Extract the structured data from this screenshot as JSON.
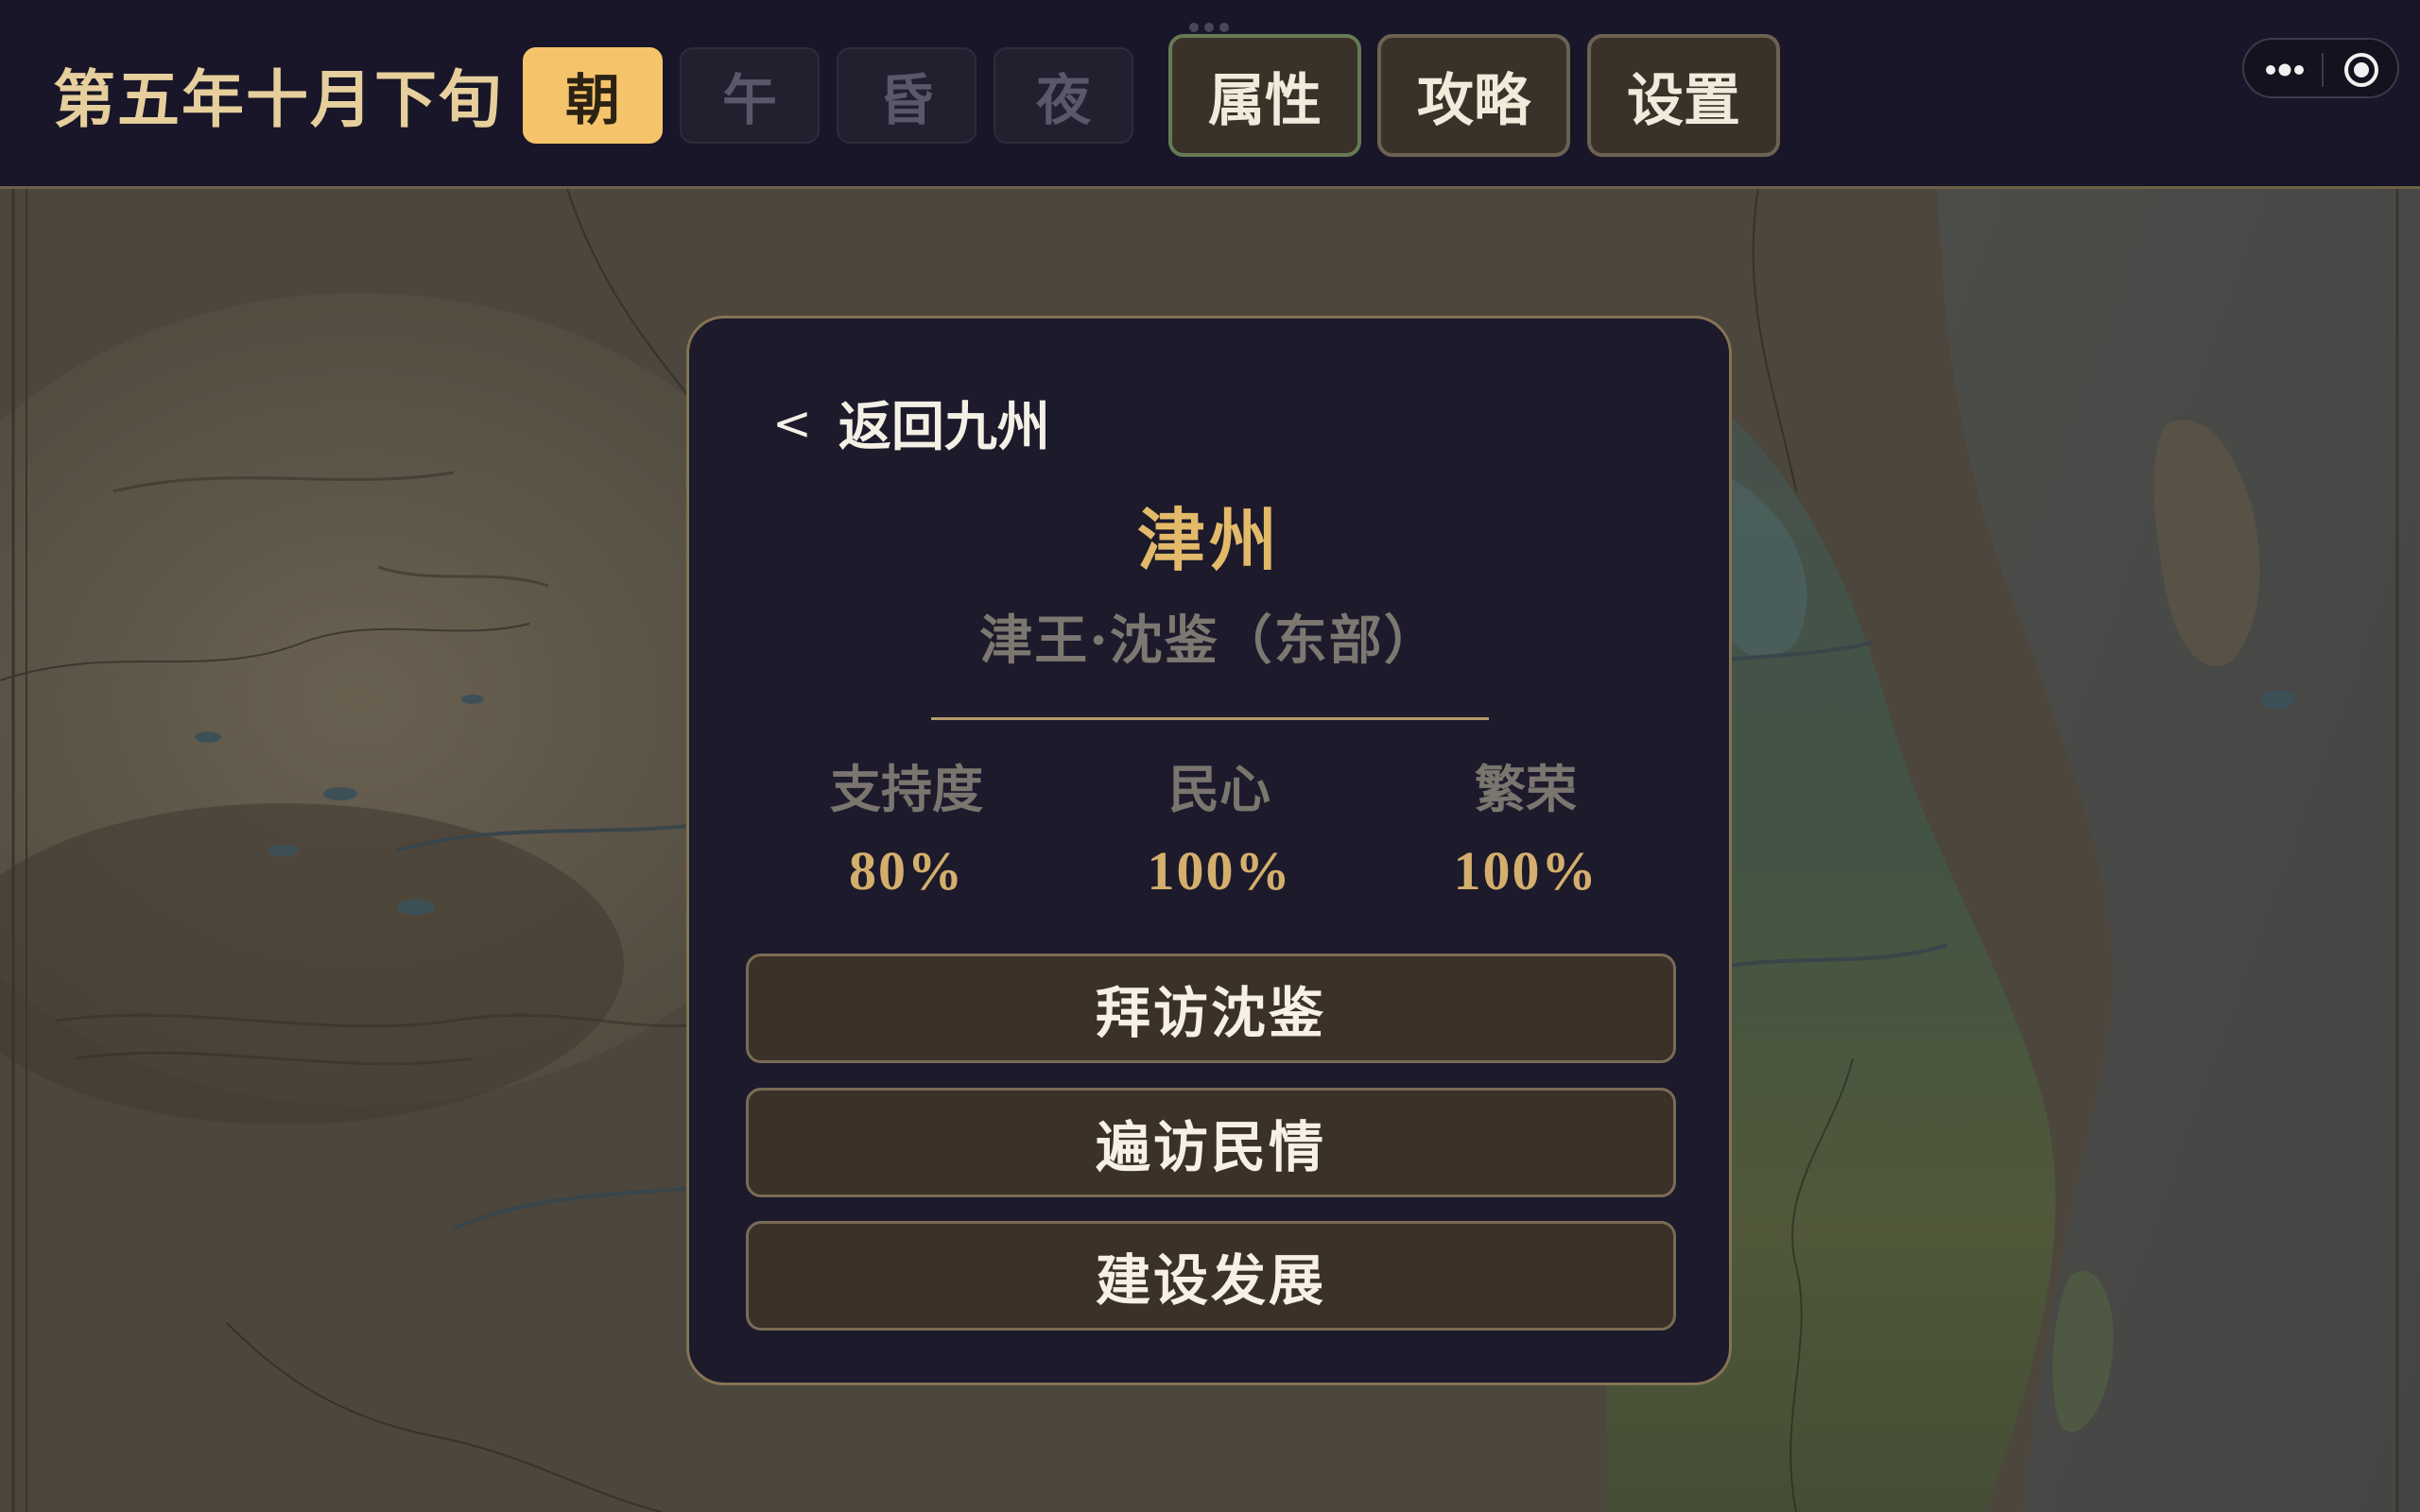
{
  "header": {
    "date": "第五年十月下旬",
    "periods": [
      {
        "label": "朝",
        "active": true
      },
      {
        "label": "午",
        "active": false
      },
      {
        "label": "昏",
        "active": false
      },
      {
        "label": "夜",
        "active": false
      }
    ],
    "menu": {
      "attributes": "属性",
      "guide": "攻略",
      "settings": "设置"
    }
  },
  "system": {
    "more_icon": "more-dots-icon",
    "close_icon": "record-circle-icon"
  },
  "panel": {
    "back_label": "返回九州",
    "back_icon": "chevron-left-icon",
    "city_name": "津州",
    "ruler": "津王·沈鉴（东部）",
    "stats": [
      {
        "label": "支持度",
        "value": "80%"
      },
      {
        "label": "民心",
        "value": "100%"
      },
      {
        "label": "繁荣",
        "value": "100%"
      }
    ],
    "actions": [
      "拜访沈鉴",
      "遍访民情",
      "建设发展"
    ]
  },
  "colors": {
    "accent_gold": "#f5c46a",
    "panel_bg": "#1c1a2b",
    "topbar_bg": "#181628",
    "button_brown": "#3b3128"
  }
}
